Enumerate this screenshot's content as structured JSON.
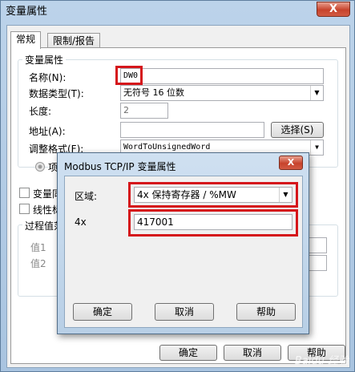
{
  "window": {
    "title": "变量属性",
    "close": "X"
  },
  "tabs": [
    {
      "label": "常规"
    },
    {
      "label": "限制/报告"
    }
  ],
  "props": {
    "group_title": "变量属性",
    "name_label": "名称(N):",
    "name_value": "DW0",
    "type_label": "数据类型(T):",
    "type_value": "无符号 16 位数",
    "length_label": "长度:",
    "length_value": "2",
    "address_label": "地址(A):",
    "address_value": "",
    "select_button": "选择(S)",
    "adjust_label": "调整格式(F):",
    "adjust_value": "WordToUnsignedWord",
    "radio_label": "项"
  },
  "obscured": {
    "var_check": "变量同",
    "linear_check": "线性标",
    "process_group": "过程值范",
    "value1": "值1",
    "value2": "值2"
  },
  "bottom_buttons": {
    "ok": "确定",
    "cancel": "取消",
    "help": "帮助"
  },
  "modbus": {
    "title": "Modbus TCP/IP 变量属性",
    "close": "X",
    "area_label": "区域:",
    "area_value": "4x 保持寄存器 / %MW",
    "addr_label": "4x",
    "addr_value": "417001",
    "ok": "确定",
    "cancel": "取消",
    "help": "帮助"
  },
  "watermark": "Baidu 经验",
  "colors": {
    "highlight": "#d5161b",
    "title_bar": "#bcd3ea"
  }
}
